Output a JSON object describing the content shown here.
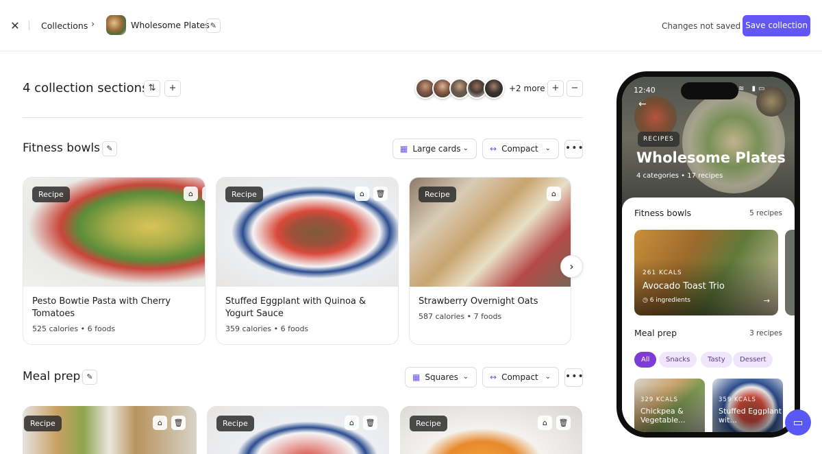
{
  "header": {
    "breadcrumb": "Collections",
    "collection_name": "Wholesome Plates",
    "status": "Changes not saved",
    "save_label": "Save collection"
  },
  "summary": {
    "sections_label": "4 collection sections",
    "more_label": "+2 more"
  },
  "sections": [
    {
      "title": "Fitness bowls",
      "layout": "Large cards",
      "density": "Compact",
      "cards": [
        {
          "tag": "Recipe",
          "name": "Pesto Bowtie Pasta with Cherry Tomatoes",
          "meta": "525 calories • 6 foods"
        },
        {
          "tag": "Recipe",
          "name": "Stuffed Eggplant with Quinoa & Yogurt Sauce",
          "meta": "359 calories • 6 foods"
        },
        {
          "tag": "Recipe",
          "name": "Strawberry Overnight Oats",
          "meta": "587 calories • 7 foods"
        }
      ]
    },
    {
      "title": "Meal prep",
      "layout": "Squares",
      "density": "Compact",
      "cards": [
        {
          "tag": "Recipe"
        },
        {
          "tag": "Recipe"
        },
        {
          "tag": "Recipe"
        }
      ]
    }
  ],
  "phone": {
    "time": "12:40",
    "tag": "RECIPES",
    "title": "Wholesome Plates",
    "subtitle": "4 categories  •  17 recipes",
    "sections": [
      {
        "title": "Fitness bowls",
        "count": "5 recipes"
      },
      {
        "title": "Meal prep",
        "count": "3 recipes"
      }
    ],
    "feature": {
      "kcal": "261 KCALS",
      "name": "Avocado Toast Trio",
      "ingredients": "6 ingredients"
    },
    "chips": [
      "All",
      "Snacks",
      "Tasty",
      "Dessert"
    ],
    "mini_cards": [
      {
        "kcal": "329 KCALS",
        "name": "Chickpea & Vegetable..."
      },
      {
        "kcal": "359 KCALS",
        "name": "Stuffed Eggplant wit..."
      }
    ]
  },
  "colors": {
    "accent": "#6257f5",
    "chip_active": "#7e3bd6",
    "chip": "#f0e6fb"
  }
}
